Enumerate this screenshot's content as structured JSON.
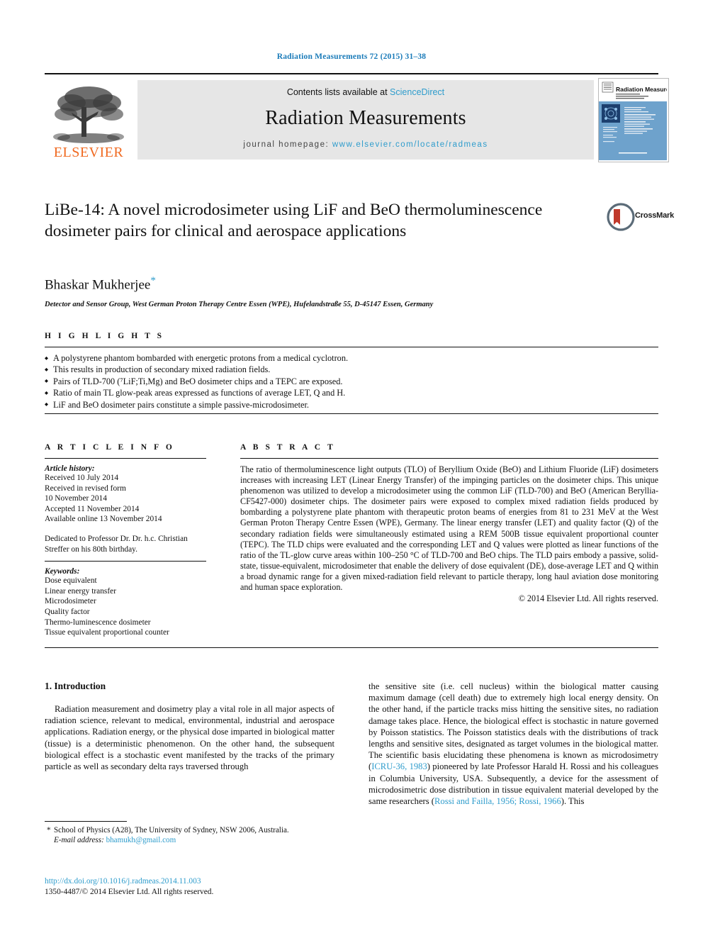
{
  "running_head": "Radiation Measurements 72 (2015) 31–38",
  "banner": {
    "publisher_logo_name": "elsevier-logo",
    "publisher_wordmark": "ELSEVIER",
    "contents_prefix": "Contents lists available at",
    "contents_link": "ScienceDirect",
    "journal_name": "Radiation Measurements",
    "homepage_prefix": "journal homepage:",
    "homepage_url": "www.elsevier.com/locate/radmeas",
    "cover_title": "Radiation Measurements"
  },
  "article": {
    "title": "LiBe-14: A novel microdosimeter using LiF and BeO thermoluminescence dosimeter pairs for clinical and aerospace applications",
    "crossmark_label": "CrossMark",
    "author": "Bhaskar Mukherjee",
    "author_marker": "*",
    "affiliation": "Detector and Sensor Group, West German Proton Therapy Centre Essen (WPE), Hufelandstraße 55, D-45147 Essen, Germany"
  },
  "highlights": {
    "heading": "H I G H L I G H T S",
    "items": [
      "A polystyrene phantom bombarded with energetic protons from a medical cyclotron.",
      "This results in production of secondary mixed radiation fields.",
      "Pairs of TLD-700 (⁷LiF;Ti,Mg) and BeO dosimeter chips and a TEPC are exposed.",
      "Ratio of main TL glow-peak areas expressed as functions of average LET, Q and H.",
      "LiF and BeO dosimeter pairs constitute a simple passive-microdosimeter."
    ]
  },
  "article_info": {
    "heading": "A R T I C L E   I N F O",
    "history_label": "Article history:",
    "history_lines": [
      "Received 10 July 2014",
      "Received in revised form",
      "10 November 2014",
      "Accepted 11 November 2014",
      "Available online 13 November 2014"
    ],
    "dedication": "Dedicated to Professor Dr. Dr. h.c. Christian Streffer on his 80th birthday.",
    "keywords_label": "Keywords:",
    "keywords": [
      "Dose equivalent",
      "Linear energy transfer",
      "Microdosimeter",
      "Quality factor",
      "Thermo-luminescence dosimeter",
      "Tissue equivalent proportional counter"
    ]
  },
  "abstract": {
    "heading": "A B S T R A C T",
    "text": "The ratio of thermoluminescence light outputs (TLO) of Beryllium Oxide (BeO) and Lithium Fluoride (LiF) dosimeters increases with increasing LET (Linear Energy Transfer) of the impinging particles on the dosimeter chips. This unique phenomenon was utilized to develop a microdosimeter using the common LiF (TLD-700) and BeO (American Beryllia-CF5427-000) dosimeter chips. The dosimeter pairs were exposed to complex mixed radiation fields produced by bombarding a polystyrene plate phantom with therapeutic proton beams of energies from 81 to 231 MeV at the West German Proton Therapy Centre Essen (WPE), Germany. The linear energy transfer (LET) and quality factor (Q) of the secondary radiation fields were simultaneously estimated using a REM 500B tissue equivalent proportional counter (TEPC). The TLD chips were evaluated and the corresponding LET and Q values were plotted as linear functions of the ratio of the TL-glow curve areas within 100–250 °C of TLD-700 and BeO chips. The TLD pairs embody a passive, solid-state, tissue-equivalent, microdosimeter that enable the delivery of dose equivalent (DE), dose-average LET and Q within a broad dynamic range for a given mixed-radiation field relevant to particle therapy, long haul aviation dose monitoring and human space exploration.",
    "copyright": "© 2014 Elsevier Ltd. All rights reserved."
  },
  "body": {
    "section_number_title": "1. Introduction",
    "left_paragraph": "Radiation measurement and dosimetry play a vital role in all major aspects of radiation science, relevant to medical, environmental, industrial and aerospace applications. Radiation energy, or the physical dose imparted in biological matter (tissue) is a deterministic phenomenon. On the other hand, the subsequent biological effect is a stochastic event manifested by the tracks of the primary particle as well as secondary delta rays traversed through",
    "right_part_1": "the sensitive site (i.e. cell nucleus) within the biological matter causing maximum damage (cell death) due to extremely high local energy density. On the other hand, if the particle tracks miss hitting the sensitive sites, no radiation damage takes place. Hence, the biological effect is stochastic in nature governed by Poisson statistics. The Poisson statistics deals with the distributions of track lengths and sensitive sites, designated as target volumes in the biological matter. The scientific basis elucidating these phenomena is known as microdosimetry (",
    "right_citation_1": "ICRU-36, 1983",
    "right_part_2": ") pioneered by late Professor Harald H. Rossi and his colleagues in Columbia University, USA. Subsequently, a device for the assessment of microdosimetric dose distribution in tissue equivalent material developed by the same researchers (",
    "right_citation_2": "Rossi and Failla, 1956; Rossi, 1966",
    "right_part_3": "). This"
  },
  "footnotes": {
    "marker": "*",
    "corresponding_affiliation": "School of Physics (A28), The University of Sydney, NSW 2006, Australia.",
    "email_label": "E-mail address:",
    "email": "bhamukh@gmail.com",
    "doi": "http://dx.doi.org/10.1016/j.radmeas.2014.11.003",
    "issn_line": "1350-4487/© 2014 Elsevier Ltd. All rights reserved."
  },
  "colors": {
    "link_blue": "#2e9ccc",
    "header_blue": "#1a7bb9",
    "elsevier_orange": "#f06a21",
    "banner_grey": "#e6e6e6",
    "crossmark_red": "#c0392b"
  }
}
